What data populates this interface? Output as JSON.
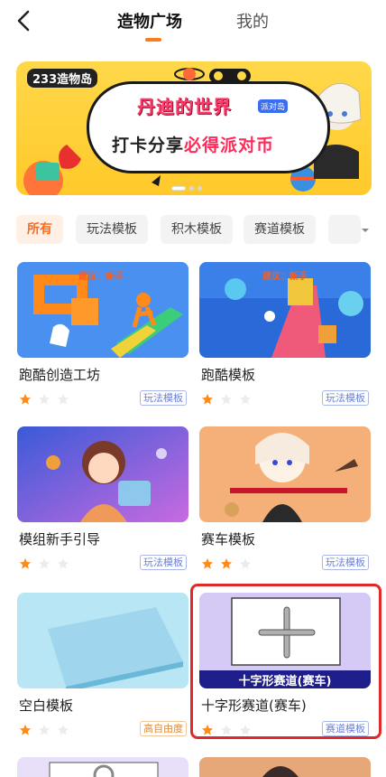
{
  "header": {
    "tab_active": "造物广场",
    "tab_inactive": "我的"
  },
  "banner": {
    "logo": "233造物岛",
    "title": "丹迪的世界",
    "badge": "派对岛",
    "subtitle_prefix": "打卡分享",
    "subtitle_highlight": "必得派对币"
  },
  "filters": {
    "items": [
      "所有",
      "玩法模板",
      "积木模板",
      "赛道模板"
    ],
    "active": "所有"
  },
  "cards": [
    {
      "title": "跑酷创造工坊",
      "tag": "玩法模板",
      "stars": 1,
      "hint": "建议：新手"
    },
    {
      "title": "跑酷模板",
      "tag": "玩法模板",
      "stars": 1,
      "hint": "建议：新手"
    },
    {
      "title": "模组新手引导",
      "tag": "玩法模板",
      "stars": 1
    },
    {
      "title": "赛车模板",
      "tag": "玩法模板",
      "stars": 2
    },
    {
      "title": "空白模板",
      "tag": "高自由度",
      "stars": 1
    },
    {
      "title": "十字形赛道(赛车)",
      "tag": "赛道模板",
      "stars": 1,
      "thumb_caption": "十字形赛道(赛车)"
    }
  ],
  "colors": {
    "accent": "#ff7a1a",
    "star_filled": "#ff8a1a",
    "star_empty": "#ececec",
    "highlight": "#e02a2a"
  }
}
